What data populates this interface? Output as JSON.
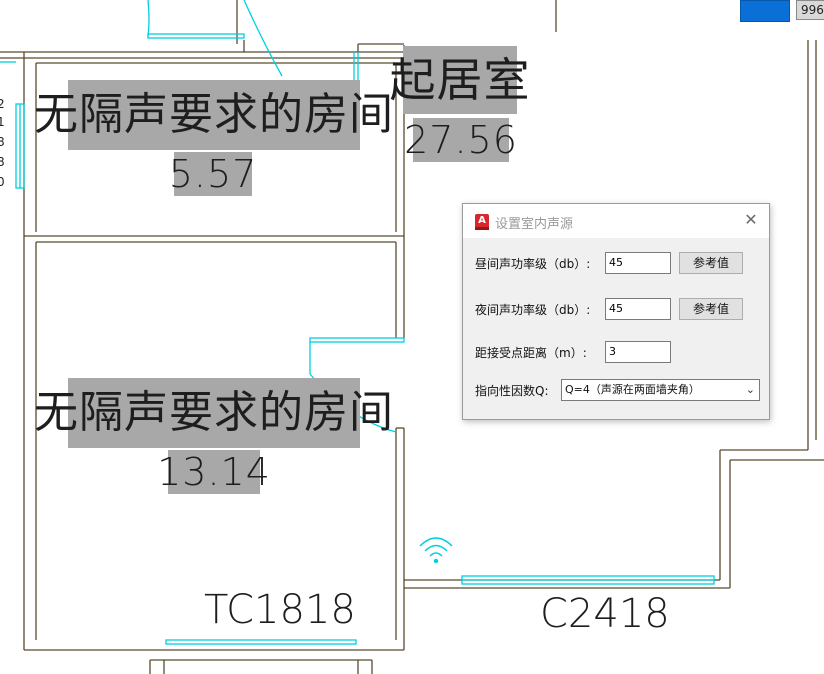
{
  "floorplan": {
    "rooms": [
      {
        "name": "无隔声要求的房间",
        "area": "5.57"
      },
      {
        "name": "起居室",
        "area": "27.56"
      },
      {
        "name": "无隔声要求的房间",
        "area": "13.14"
      }
    ],
    "window_labels": [
      "TC1818",
      "C2418"
    ],
    "top_right_tab": "996",
    "colors": {
      "wall": "#5a4a2e",
      "opening": "#00d0e0",
      "label_bg": "#a8a8a8",
      "accent_button": "#0a6fd6"
    },
    "icons": [
      "wifi-icon"
    ]
  },
  "dialog": {
    "title": "设置室内声源",
    "app_icon": "autocad-icon",
    "close_icon": "close-icon",
    "close_glyph": "✕",
    "fields": {
      "day_label": "昼间声功率级（db）:",
      "day_value": "45",
      "night_label": "夜间声功率级（db）:",
      "night_value": "45",
      "distance_label": "距接受点距离（m）:",
      "distance_value": "3",
      "directivity_label": "指向性因数Q:",
      "directivity_value": "Q=4（声源在两面墙夹角）"
    },
    "ref_button_label": "参考值"
  }
}
